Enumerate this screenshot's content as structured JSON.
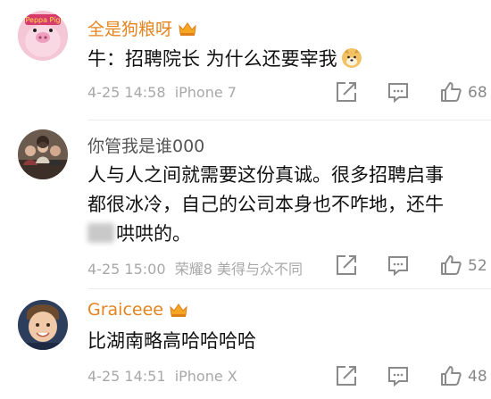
{
  "comments": [
    {
      "username": "全是狗粮呀",
      "avatar_text": "Peppa Pig",
      "text_lines": [
        "牛：招聘院长 为什么还要宰我"
      ],
      "time": "4-25 14:58",
      "device": "iPhone 7",
      "likes": "68"
    },
    {
      "username": "你管我是谁000",
      "text_lines": [
        "人与人之间就需要这份真诚。很多招聘启事",
        "都很冰冷，自己的公司本身也不咋地，还牛",
        "哄哄的。"
      ],
      "time": "4-25 15:00",
      "device": "荣耀8 美得与众不同",
      "likes": "52"
    },
    {
      "username": "Graiceee",
      "text_lines": [
        "比湖南略高哈哈哈哈"
      ],
      "time": "4-25 14:51",
      "device": "iPhone X",
      "likes": "48"
    }
  ],
  "icons": {
    "crown": "crown-vip-icon",
    "forward": "forward-icon",
    "comment": "comment-icon",
    "like": "thumbs-up-icon",
    "emoji": "doge-emoji-icon"
  },
  "colors": {
    "vip_name": "#e3841f",
    "normal_name": "#555555",
    "meta": "#a8a8a8"
  }
}
